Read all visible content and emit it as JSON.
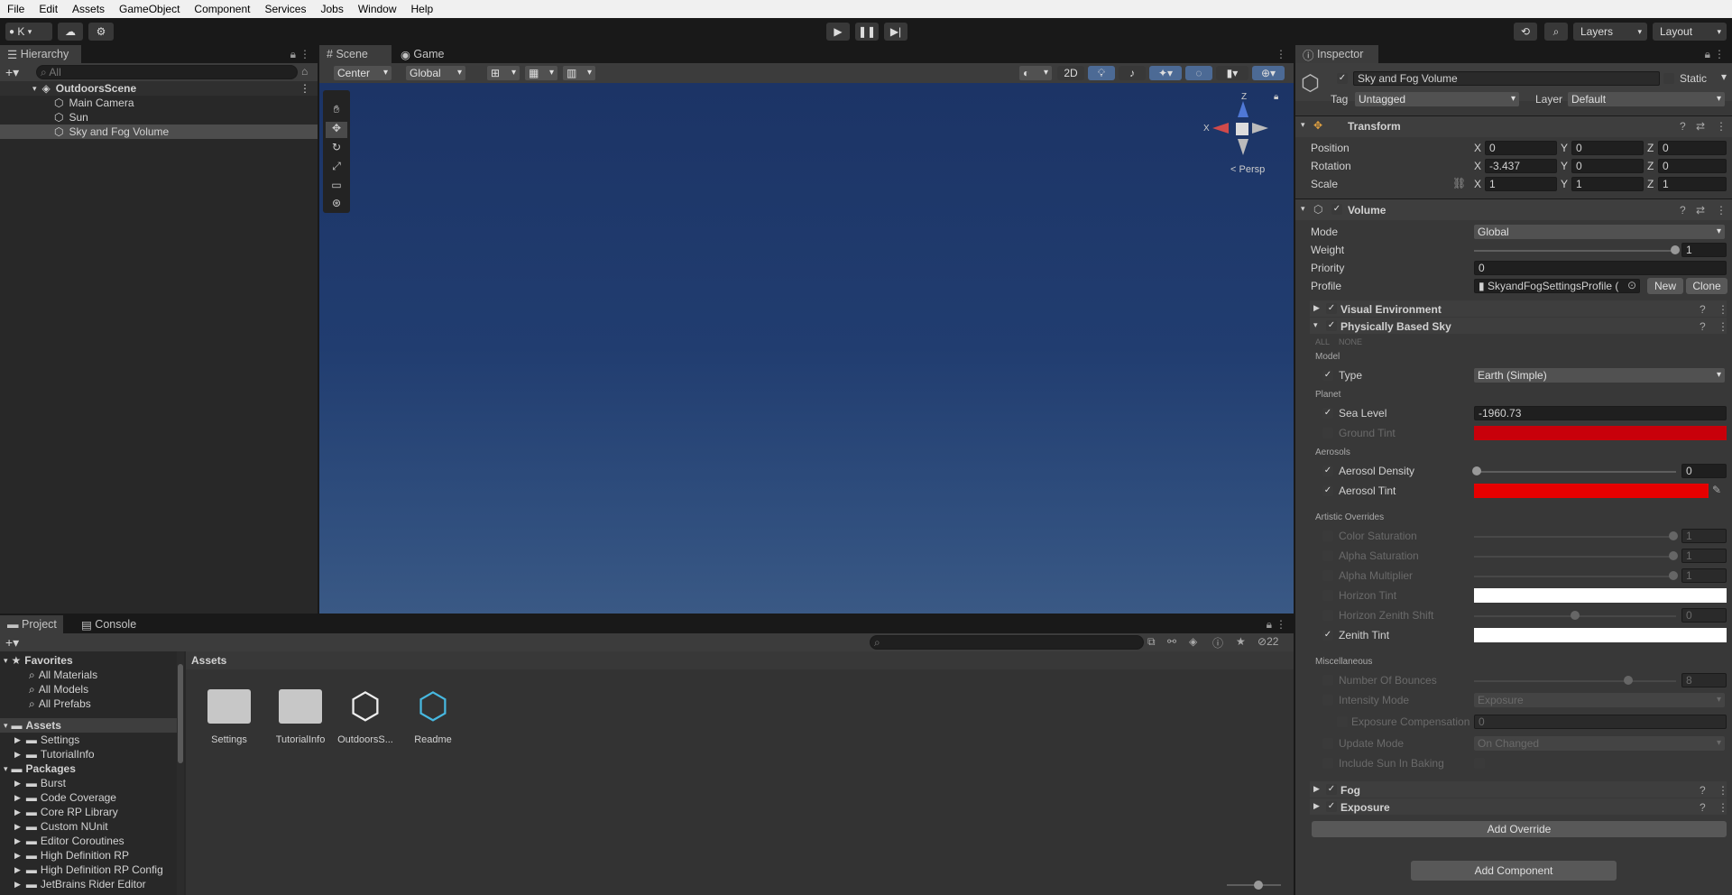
{
  "menu": [
    "File",
    "Edit",
    "Assets",
    "GameObject",
    "Component",
    "Services",
    "Jobs",
    "Window",
    "Help"
  ],
  "toolbar": {
    "account": "K",
    "history_icon": "history-icon",
    "search_icon": "search-icon",
    "layers": "Layers",
    "layout": "Layout"
  },
  "hierarchy": {
    "tab": "Hierarchy",
    "search_placeholder": "All",
    "scene": "OutdoorsScene",
    "items": [
      "Main Camera",
      "Sun",
      "Sky and Fog Volume"
    ]
  },
  "scene_view": {
    "tabs": [
      "Scene",
      "Game"
    ],
    "pivot": "Center",
    "space": "Global",
    "mode_2d": "2D",
    "persp": "Persp",
    "gizmo_axes": {
      "y": "Z",
      "x": "X"
    }
  },
  "project": {
    "tabs": [
      "Project",
      "Console"
    ],
    "hidden_count": "22",
    "favorites": {
      "label": "Favorites",
      "items": [
        "All Materials",
        "All Models",
        "All Prefabs"
      ]
    },
    "assets": {
      "label": "Assets",
      "items": [
        "Settings",
        "TutorialInfo"
      ]
    },
    "packages": {
      "label": "Packages",
      "items": [
        "Burst",
        "Code Coverage",
        "Core RP Library",
        "Custom NUnit",
        "Editor Coroutines",
        "High Definition RP",
        "High Definition RP Config",
        "JetBrains Rider Editor"
      ]
    },
    "breadcrumb": "Assets",
    "grid": [
      "Settings",
      "TutorialInfo",
      "OutdoorsS...",
      "Readme"
    ]
  },
  "inspector": {
    "tab": "Inspector",
    "object_name": "Sky and Fog Volume",
    "static_label": "Static",
    "tag_label": "Tag",
    "tag_value": "Untagged",
    "layer_label": "Layer",
    "layer_value": "Default",
    "transform": {
      "title": "Transform",
      "position_label": "Position",
      "position": [
        "0",
        "0",
        "0"
      ],
      "rotation_label": "Rotation",
      "rotation": [
        "-3.437",
        "0",
        "0"
      ],
      "scale_label": "Scale",
      "scale": [
        "1",
        "1",
        "1"
      ],
      "axes": [
        "X",
        "Y",
        "Z"
      ]
    },
    "volume": {
      "title": "Volume",
      "mode_label": "Mode",
      "mode": "Global",
      "weight_label": "Weight",
      "weight": "1",
      "priority_label": "Priority",
      "priority": "0",
      "profile_label": "Profile",
      "profile": "SkyandFogSettingsProfile (",
      "new_btn": "New",
      "clone_btn": "Clone"
    },
    "overrides": {
      "visual_env": "Visual Environment",
      "pbs": "Physically Based Sky",
      "all": "ALL",
      "none": "NONE",
      "model_header": "Model",
      "type_label": "Type",
      "type": "Earth (Simple)",
      "planet_header": "Planet",
      "sea_level_label": "Sea Level",
      "sea_level": "-1960.73",
      "ground_tint_label": "Ground Tint",
      "aerosols_header": "Aerosols",
      "aerosol_density_label": "Aerosol Density",
      "aerosol_density": "0",
      "aerosol_tint_label": "Aerosol Tint",
      "artistic_header": "Artistic Overrides",
      "color_sat_label": "Color Saturation",
      "color_sat": "1",
      "alpha_sat_label": "Alpha Saturation",
      "alpha_sat": "1",
      "alpha_mult_label": "Alpha Multiplier",
      "alpha_mult": "1",
      "horizon_tint_label": "Horizon Tint",
      "horizon_shift_label": "Horizon Zenith Shift",
      "horizon_shift": "0",
      "zenith_tint_label": "Zenith Tint",
      "misc_header": "Miscellaneous",
      "bounces_label": "Number Of Bounces",
      "bounces": "8",
      "intensity_label": "Intensity Mode",
      "intensity": "Exposure",
      "exp_comp_label": "Exposure Compensation",
      "exp_comp": "0",
      "update_label": "Update Mode",
      "update": "On Changed",
      "include_sun_label": "Include Sun In Baking",
      "fog": "Fog",
      "exposure": "Exposure",
      "add_override": "Add Override"
    },
    "add_component": "Add Component",
    "colors": {
      "ground_tint": "#c8000a",
      "aerosol_tint": "#e60000",
      "horizon_tint": "#ffffff",
      "zenith_tint": "#ffffff"
    }
  }
}
